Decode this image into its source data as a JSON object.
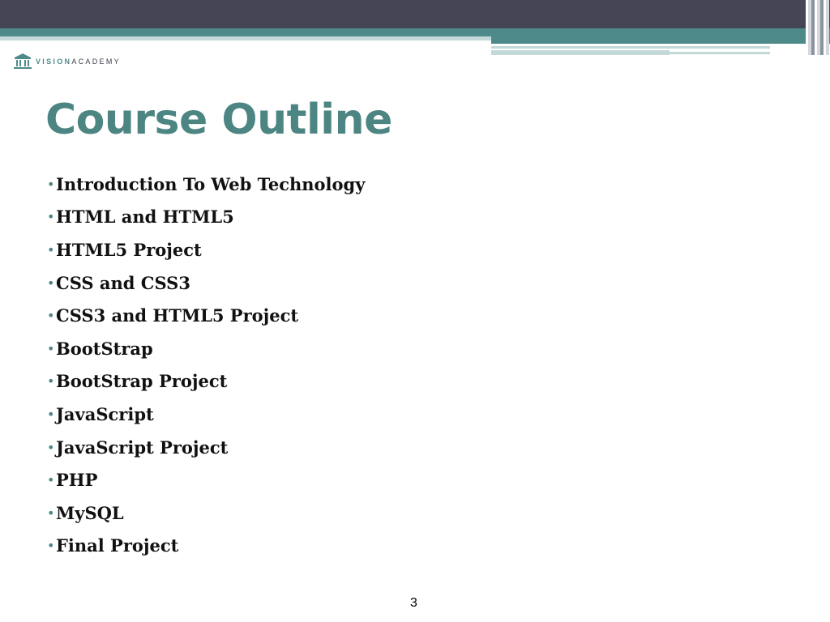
{
  "logo": {
    "brand_part1": "VISION",
    "brand_part2": "ACADEMY"
  },
  "slide": {
    "title": "Course Outline",
    "items": [
      "Introduction To Web Technology",
      "HTML and HTML5",
      "HTML5 Project",
      "CSS and CSS3",
      "CSS3 and HTML5 Project",
      "BootStrap",
      "BootStrap Project",
      "JavaScript",
      "JavaScript Project",
      "PHP",
      "MySQL",
      "Final Project"
    ],
    "bullet_glyph": "•",
    "page_number": "3"
  },
  "colors": {
    "header_dark": "#454555",
    "accent_teal": "#4f8a8b",
    "title_color": "#4d8583",
    "light_band": "#c3d8d8"
  },
  "icons": {
    "logo": "academy-building-icon"
  }
}
